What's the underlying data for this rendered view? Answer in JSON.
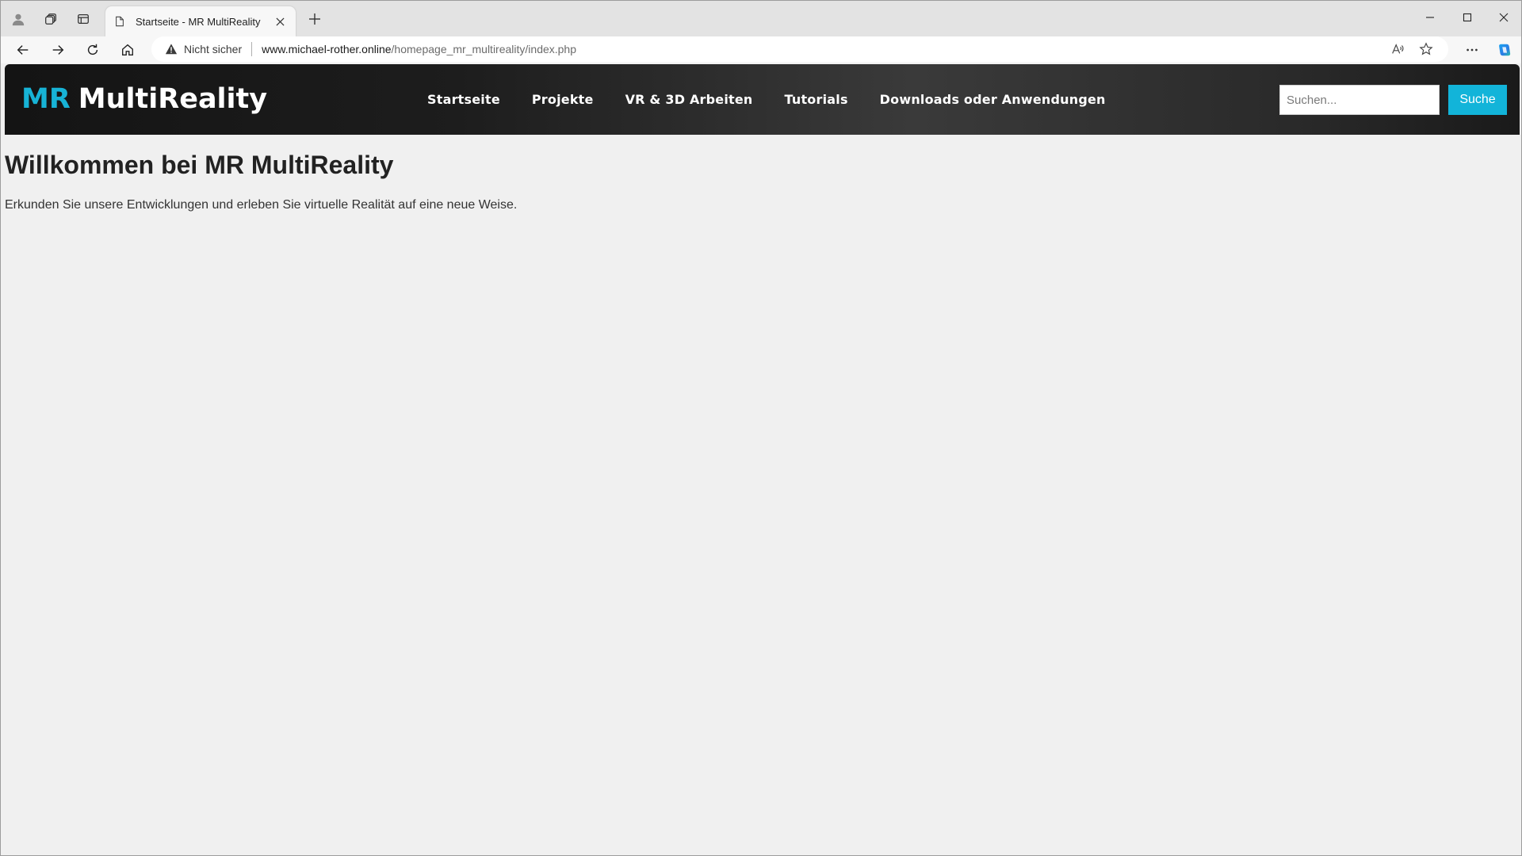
{
  "browser": {
    "tab": {
      "title": "Startseite - MR MultiReality"
    },
    "address_bar": {
      "security_label": "Nicht sicher",
      "url_host": "www.michael-rother.online",
      "url_path": "/homepage_mr_multireality/index.php"
    },
    "icons": {
      "profile": "profile-icon",
      "workspaces": "workspaces-icon",
      "tab_actions": "vertical-tabs-icon",
      "page": "page-icon",
      "close_tab": "close-icon",
      "new_tab": "plus-icon",
      "back": "back-arrow-icon",
      "forward": "forward-arrow-icon",
      "reload": "reload-icon",
      "home": "home-icon",
      "warning": "warning-icon",
      "read_aloud": "read-aloud-icon",
      "favorite": "star-icon",
      "menu": "more-icon",
      "copilot": "copilot-icon"
    }
  },
  "site": {
    "logo": {
      "mark": "MR",
      "name": "MultiReality"
    },
    "nav": [
      {
        "label": "Startseite"
      },
      {
        "label": "Projekte"
      },
      {
        "label": "VR & 3D Arbeiten"
      },
      {
        "label": "Tutorials"
      },
      {
        "label": "Downloads oder Anwendungen"
      }
    ],
    "search": {
      "placeholder": "Suchen...",
      "value": "",
      "button_label": "Suche"
    }
  },
  "main": {
    "title": "Willkommen bei MR MultiReality",
    "text": "Erkunden Sie unsere Entwicklungen und erleben Sie virtuelle Realität auf eine neue Weise."
  },
  "colors": {
    "accent": "#12b4d9",
    "header_dark": "#1a1a1a",
    "page_background": "#f0f0f0"
  }
}
